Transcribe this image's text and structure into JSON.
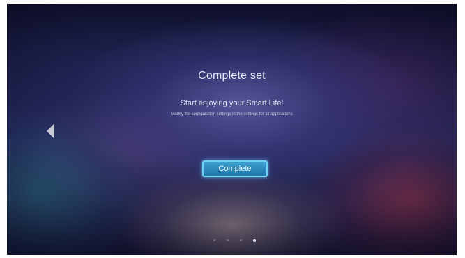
{
  "setup": {
    "title": "Complete set",
    "subtitle": "Start enjoying your Smart Life!",
    "description": "Modify the configuration settings in the settings for all applications",
    "complete_label": "Complete"
  },
  "navigation": {
    "back_icon": "back-arrow-icon"
  },
  "pager": {
    "total_pages": 4,
    "current_page": 4
  },
  "colors": {
    "accent": "#2b88bb",
    "accent_border": "#6fd0f2",
    "text": "#e6e8f4"
  }
}
